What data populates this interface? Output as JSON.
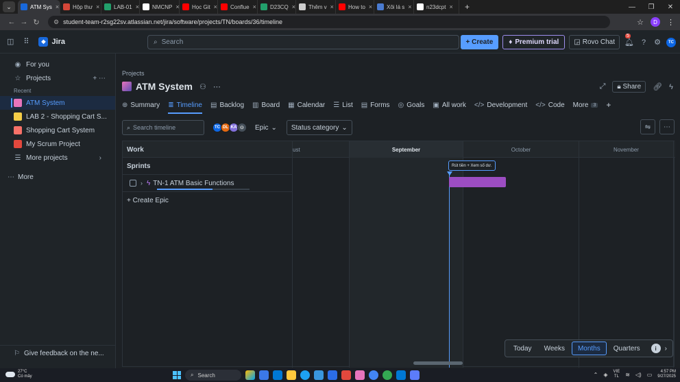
{
  "browser": {
    "tabs": [
      {
        "label": "ATM Sys",
        "color": "#1868db",
        "active": true
      },
      {
        "label": "Hộp thư",
        "color": "#d44638",
        "active": false
      },
      {
        "label": "LAB-01",
        "color": "#22a06b",
        "active": false
      },
      {
        "label": "NMCNP",
        "color": "#ffffff",
        "active": false
      },
      {
        "label": "Học Git",
        "color": "#ff0000",
        "active": false
      },
      {
        "label": "Conflue",
        "color": "#ff0000",
        "active": false
      },
      {
        "label": "D23CQ",
        "color": "#22a06b",
        "active": false
      },
      {
        "label": "Thêm v",
        "color": "#cccccc",
        "active": false
      },
      {
        "label": "How to",
        "color": "#ff0000",
        "active": false
      },
      {
        "label": "Xôi lá s",
        "color": "#4a7bd0",
        "active": false
      },
      {
        "label": "n23dcpt",
        "color": "#ffffff",
        "active": false
      }
    ],
    "url": "student-team-r2sg22sv.atlassian.net/jira/software/projects/TN/boards/36/timeline",
    "profile_initial": "D"
  },
  "topnav": {
    "app_name": "Jira",
    "search_placeholder": "Search",
    "create_label": "+ Create",
    "premium_label": "Premium trial",
    "rovo_label": "Rovo Chat",
    "notif_count": "5",
    "avatar_initials": "TC"
  },
  "sidebar": {
    "for_you": "For you",
    "projects": "Projects",
    "recent_label": "Recent",
    "items": [
      {
        "label": "ATM System",
        "color": "#e774bb",
        "active": true
      },
      {
        "label": "LAB 2 - Shopping Cart S...",
        "color": "#f5cd47",
        "active": false
      },
      {
        "label": "Shopping Cart System",
        "color": "#f87168",
        "active": false
      },
      {
        "label": "My Scrum Project",
        "color": "#e2483d",
        "active": false
      }
    ],
    "more_projects": "More projects",
    "more": "More",
    "feedback": "Give feedback on the ne..."
  },
  "project": {
    "breadcrumb": "Projects",
    "name": "ATM System",
    "share_label": "Share"
  },
  "tabs": [
    {
      "icon": "⊕",
      "label": "Summary",
      "active": false
    },
    {
      "icon": "≣",
      "label": "Timeline",
      "active": true
    },
    {
      "icon": "▤",
      "label": "Backlog",
      "active": false
    },
    {
      "icon": "▥",
      "label": "Board",
      "active": false
    },
    {
      "icon": "▦",
      "label": "Calendar",
      "active": false
    },
    {
      "icon": "☰",
      "label": "List",
      "active": false
    },
    {
      "icon": "▤",
      "label": "Forms",
      "active": false
    },
    {
      "icon": "◎",
      "label": "Goals",
      "active": false
    },
    {
      "icon": "▣",
      "label": "All work",
      "active": false
    },
    {
      "icon": "</>",
      "label": "Development",
      "active": false
    },
    {
      "icon": "</>",
      "label": "Code",
      "active": false
    }
  ],
  "more_tab": {
    "label": "More",
    "count": "3"
  },
  "toolbar": {
    "search_placeholder": "Search timeline",
    "avatars": [
      {
        "initials": "TC",
        "color": "#0c66e4"
      },
      {
        "initials": "DL",
        "color": "#e56910"
      },
      {
        "initials": "KA",
        "color": "#8270db"
      }
    ],
    "epic_label": "Epic",
    "status_label": "Status category"
  },
  "timeline": {
    "work_header": "Work",
    "months": [
      "ust",
      "September",
      "October",
      "November"
    ],
    "sprints_label": "Sprints",
    "sprint_name": "Rút tiền + Xem số dư.",
    "epic_label": "TN-1 ATM Basic Functions",
    "epic_progress": 0.6,
    "create_epic": "+ Create Epic"
  },
  "zoom": {
    "options": [
      "Today",
      "Weeks",
      "Months",
      "Quarters"
    ],
    "active": "Months"
  },
  "taskbar": {
    "temp": "27°C",
    "weather": "Có mây",
    "search": "Search",
    "lang_top": "VIE",
    "lang_bottom": "TL",
    "time": "4:57 PM",
    "date": "9/27/2025"
  }
}
